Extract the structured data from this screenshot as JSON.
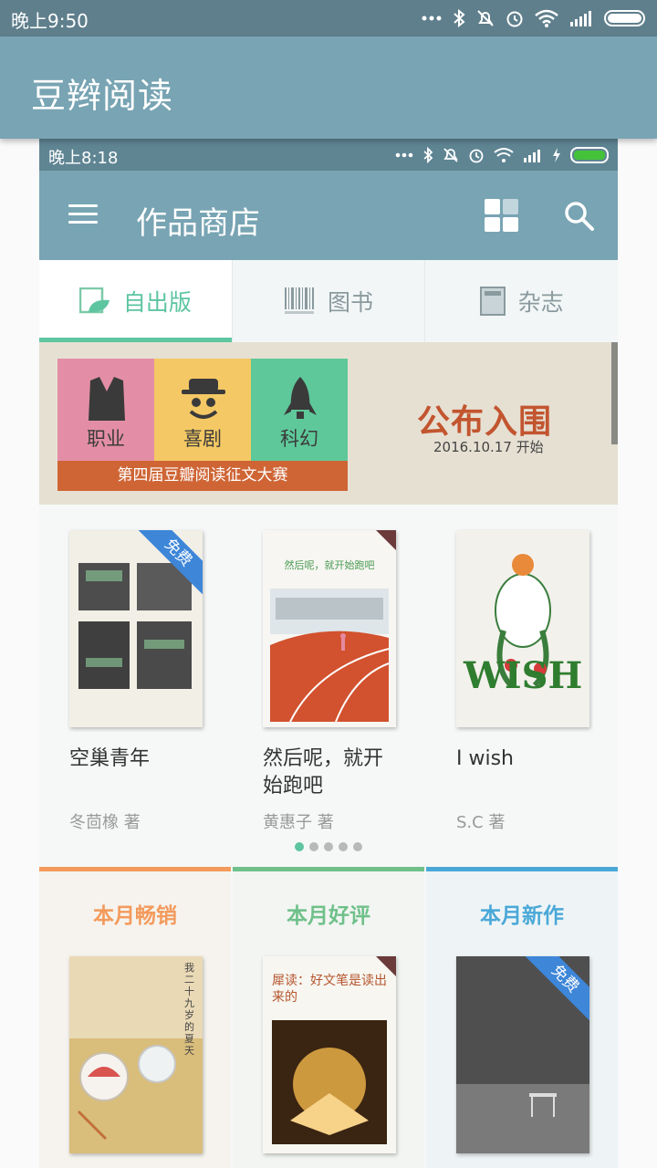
{
  "status_outer": {
    "time": "晚上9:50"
  },
  "app": {
    "title": "豆辫阅读"
  },
  "status_inner": {
    "time": "晚上8:18"
  },
  "store": {
    "title": "作品商店"
  },
  "tabs": [
    {
      "label": "自出版",
      "icon": "self-publish-icon",
      "active": true
    },
    {
      "label": "图书",
      "icon": "barcode-icon",
      "active": false
    },
    {
      "label": "杂志",
      "icon": "magazine-icon",
      "active": false
    }
  ],
  "banner": {
    "genres": [
      "职业",
      "喜剧",
      "科幻"
    ],
    "contest": "第四届豆瓣阅读征文大赛",
    "headline": "公布入围",
    "date": "2016.10.17 开始"
  },
  "books": [
    {
      "title": "空巢青年",
      "author": "冬茴橡 著",
      "badge": "免费"
    },
    {
      "title": "然后呢，就开始跑吧",
      "author": "黄惠子 著",
      "cover_text": "然后呢，就开始跑吧"
    },
    {
      "title": "I wish",
      "author": "S.C 著",
      "cover_text": "WISH"
    }
  ],
  "pager": {
    "total": 5,
    "current": 0
  },
  "categories": [
    {
      "label": "本月畅销",
      "color": "#f39a5c"
    },
    {
      "label": "本月好评",
      "color": "#6fc08a"
    },
    {
      "label": "本月新作",
      "color": "#4aa8d8",
      "badge": "免费"
    }
  ],
  "category_covers": {
    "summer": "我二十九岁的夏天",
    "reading": "犀读：好文笔是读出来的"
  },
  "colors": {
    "accent": "#5dc5a0",
    "appbar": "#78a4b3",
    "free_badge": "#3d86d8"
  }
}
